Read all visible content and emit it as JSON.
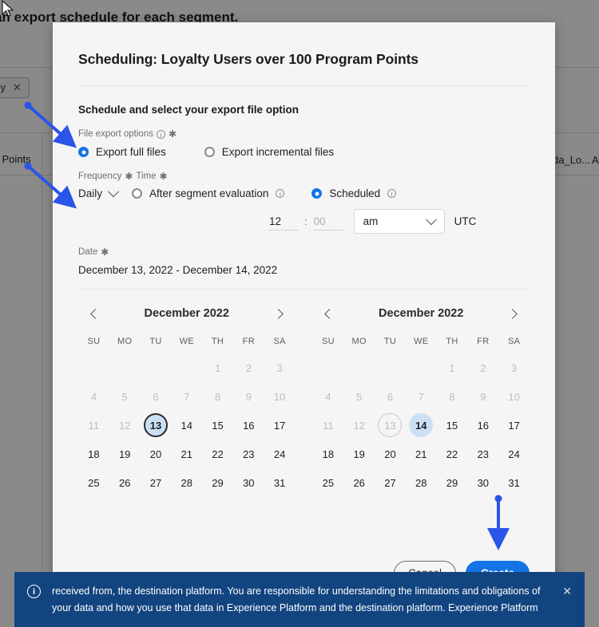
{
  "background": {
    "heading": "d an export schedule for each segment.",
    "chip_label": "only",
    "chip_close": "✕",
    "cell_left": "m Points",
    "cell_right": "da_Lo...",
    "cell_right2": "A"
  },
  "modal": {
    "title": "Scheduling: Loyalty Users over 100 Program Points",
    "section_title": "Schedule and select your export file option",
    "file_export": {
      "label": "File export options",
      "info": "i",
      "required": "✱",
      "options": [
        {
          "label": "Export full files",
          "selected": true
        },
        {
          "label": "Export incremental files",
          "selected": false
        }
      ]
    },
    "frequency": {
      "label_frequency": "Frequency",
      "label_time": "Time",
      "required": "✱",
      "select_value": "Daily",
      "after_segment": {
        "label": "After segment evaluation",
        "info": "i",
        "selected": false
      },
      "scheduled": {
        "label": "Scheduled",
        "info": "i",
        "selected": true
      },
      "hour_value": "12",
      "minute_placeholder": "00",
      "minute_value": "",
      "colon": ":",
      "ampm_value": "am",
      "timezone": "UTC"
    },
    "date": {
      "label": "Date",
      "required": "✱",
      "value": "December 13, 2022 - December 14, 2022"
    },
    "calendars": [
      {
        "month": "December 2022",
        "prev_icon": "chevron-left-icon",
        "next_icon": "chevron-right-icon",
        "dow": [
          "SU",
          "MO",
          "TU",
          "WE",
          "TH",
          "FR",
          "SA"
        ],
        "lead_blank": 4,
        "days": [
          {
            "n": 1,
            "state": "muted"
          },
          {
            "n": 2,
            "state": "muted"
          },
          {
            "n": 3,
            "state": "muted"
          },
          {
            "n": 4,
            "state": "muted"
          },
          {
            "n": 5,
            "state": "muted"
          },
          {
            "n": 6,
            "state": "muted"
          },
          {
            "n": 7,
            "state": "muted"
          },
          {
            "n": 8,
            "state": "muted"
          },
          {
            "n": 9,
            "state": "muted"
          },
          {
            "n": 10,
            "state": "muted"
          },
          {
            "n": 11,
            "state": "muted"
          },
          {
            "n": 12,
            "state": "muted"
          },
          {
            "n": 13,
            "state": "range-start"
          },
          {
            "n": 14,
            "state": "normal"
          },
          {
            "n": 15,
            "state": "normal"
          },
          {
            "n": 16,
            "state": "normal"
          },
          {
            "n": 17,
            "state": "normal"
          },
          {
            "n": 18,
            "state": "normal"
          },
          {
            "n": 19,
            "state": "normal"
          },
          {
            "n": 20,
            "state": "normal"
          },
          {
            "n": 21,
            "state": "normal"
          },
          {
            "n": 22,
            "state": "normal"
          },
          {
            "n": 23,
            "state": "normal"
          },
          {
            "n": 24,
            "state": "normal"
          },
          {
            "n": 25,
            "state": "normal"
          },
          {
            "n": 26,
            "state": "normal"
          },
          {
            "n": 27,
            "state": "normal"
          },
          {
            "n": 28,
            "state": "normal"
          },
          {
            "n": 29,
            "state": "normal"
          },
          {
            "n": 30,
            "state": "normal"
          },
          {
            "n": 31,
            "state": "normal"
          }
        ]
      },
      {
        "month": "December 2022",
        "prev_icon": "chevron-left-icon",
        "next_icon": "chevron-right-icon",
        "dow": [
          "SU",
          "MO",
          "TU",
          "WE",
          "TH",
          "FR",
          "SA"
        ],
        "lead_blank": 4,
        "days": [
          {
            "n": 1,
            "state": "muted"
          },
          {
            "n": 2,
            "state": "muted"
          },
          {
            "n": 3,
            "state": "muted"
          },
          {
            "n": 4,
            "state": "muted"
          },
          {
            "n": 5,
            "state": "muted"
          },
          {
            "n": 6,
            "state": "muted"
          },
          {
            "n": 7,
            "state": "muted"
          },
          {
            "n": 8,
            "state": "muted"
          },
          {
            "n": 9,
            "state": "muted"
          },
          {
            "n": 10,
            "state": "muted"
          },
          {
            "n": 11,
            "state": "muted"
          },
          {
            "n": 12,
            "state": "muted"
          },
          {
            "n": 13,
            "state": "outline"
          },
          {
            "n": 14,
            "state": "sel"
          },
          {
            "n": 15,
            "state": "normal"
          },
          {
            "n": 16,
            "state": "normal"
          },
          {
            "n": 17,
            "state": "normal"
          },
          {
            "n": 18,
            "state": "normal"
          },
          {
            "n": 19,
            "state": "normal"
          },
          {
            "n": 20,
            "state": "normal"
          },
          {
            "n": 21,
            "state": "normal"
          },
          {
            "n": 22,
            "state": "normal"
          },
          {
            "n": 23,
            "state": "normal"
          },
          {
            "n": 24,
            "state": "normal"
          },
          {
            "n": 25,
            "state": "normal"
          },
          {
            "n": 26,
            "state": "normal"
          },
          {
            "n": 27,
            "state": "normal"
          },
          {
            "n": 28,
            "state": "normal"
          },
          {
            "n": 29,
            "state": "normal"
          },
          {
            "n": 30,
            "state": "normal"
          },
          {
            "n": 31,
            "state": "normal"
          }
        ]
      }
    ],
    "footer": {
      "cancel_label": "Cancel",
      "create_label": "Create"
    }
  },
  "banner": {
    "icon": "info-icon",
    "icon_glyph": "i",
    "text": "received from, the destination platform. You are responsible for understanding the limitations and obligations of your data and how you use that data in Experience Platform and the destination platform. Experience Platform",
    "close_label": "✕"
  },
  "colors": {
    "accent": "#1473e6",
    "selected_day": "#cce0f5",
    "banner_bg": "#12447f",
    "annotation_arrow": "#2b55e8",
    "modal_bg": "#f5f5f5"
  }
}
